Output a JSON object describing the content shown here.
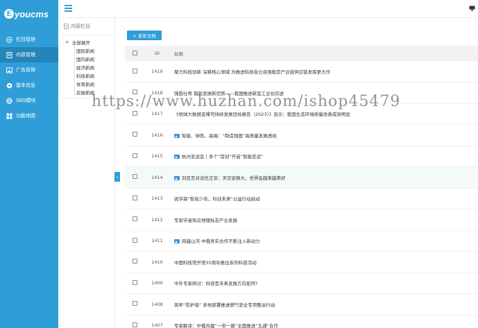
{
  "logo": {
    "mark": "E",
    "text": "youcms"
  },
  "sidebar": {
    "items": [
      {
        "label": "栏目管理",
        "icon": "grid-icon"
      },
      {
        "label": "内容管理",
        "icon": "document-icon",
        "active": true
      },
      {
        "label": "广告管理",
        "icon": "image-icon"
      },
      {
        "label": "基本信息",
        "icon": "settings-icon"
      },
      {
        "label": "SEO模块",
        "icon": "globe-icon"
      },
      {
        "label": "功能地图",
        "icon": "map-icon"
      }
    ]
  },
  "tree": {
    "header": "内容栏目",
    "root": "全部展开",
    "children": [
      "国际新闻",
      "国内新闻",
      "经济新闻",
      "科技新闻",
      "体育新闻",
      "房屋新闻"
    ]
  },
  "toolbar": {
    "publish_label": "+ 发布文档"
  },
  "table": {
    "headers": {
      "id": "ID",
      "title": "标题"
    },
    "rows": [
      {
        "id": "1419",
        "title": "聚力科技创新 深耕核心领域 为推进科技自立自强稳定产业链供应链发挥更大作",
        "img": false
      },
      {
        "id": "1418",
        "title": "强筋壮骨 锻就发展新优势——我国推进新型工业化综述",
        "img": false
      },
      {
        "id": "1417",
        "title": "《地球大数据支撑可持续发展目标报告（2023）》显示：我国生态环境质量改善成效明显",
        "img": false
      },
      {
        "id": "1416",
        "title": "智能、绿色、高端：“制造强国”高质量发展透视",
        "img": true
      },
      {
        "id": "1415",
        "title": "杭州亚运会丨多个“首创”开启“智能亚运”",
        "img": true
      },
      {
        "id": "1414",
        "title": "刘亚东对话任正非：天空足够大，世界会越来越美好",
        "img": true,
        "highlight": true
      },
      {
        "id": "1413",
        "title": "锐学森“智启少年，科创未来”公益行动启动",
        "img": false
      },
      {
        "id": "1412",
        "title": "专家学者热议地理标志产业发展",
        "img": false
      },
      {
        "id": "1411",
        "title": "跨越山河 中俄务实合作不断注入新动力",
        "img": true
      },
      {
        "id": "1410",
        "title": "中国科技馆开馆35周年推出系列科普活动",
        "img": false
      },
      {
        "id": "1409",
        "title": "中外专家研讨：科技是未来发展方向如何?",
        "img": false
      },
      {
        "id": "1408",
        "title": "筑牢“防护墙” 多地部署推进燃气安全专项整治行动",
        "img": false
      },
      {
        "id": "1407",
        "title": "专家解读：中俄共建“一带一路”全面推进“五通”合作",
        "img": false
      }
    ]
  },
  "watermark": "https://www.huzhan.com/ishop45479",
  "colors": {
    "primary": "#2f9ed8",
    "sidebar_active": "#2584b8"
  }
}
